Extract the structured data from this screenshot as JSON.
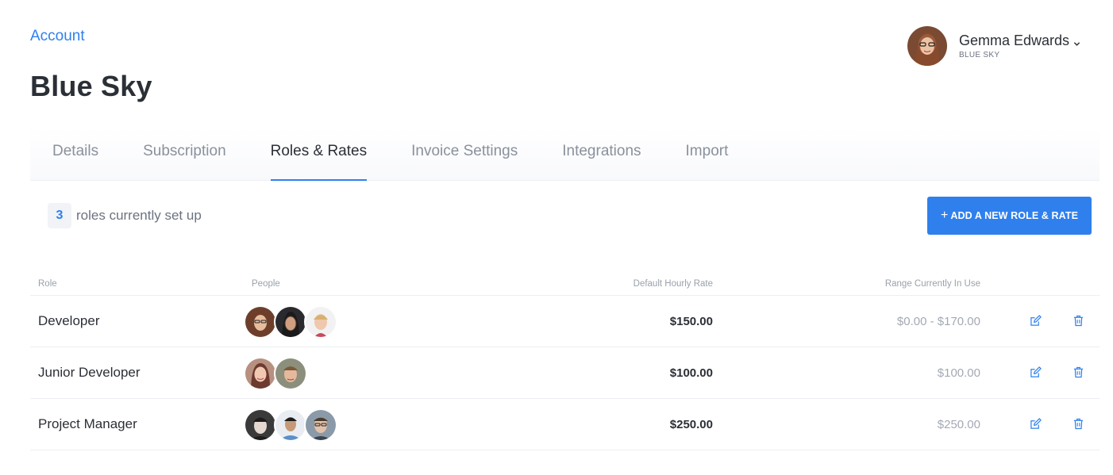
{
  "breadcrumb": "Account",
  "page_title": "Blue Sky",
  "user": {
    "name": "Gemma Edwards",
    "org": "BLUE SKY"
  },
  "tabs": [
    {
      "label": "Details",
      "active": false
    },
    {
      "label": "Subscription",
      "active": false
    },
    {
      "label": "Roles & Rates",
      "active": true
    },
    {
      "label": "Invoice Settings",
      "active": false
    },
    {
      "label": "Integrations",
      "active": false
    },
    {
      "label": "Import",
      "active": false
    }
  ],
  "summary": {
    "count": "3",
    "label": "roles currently set up"
  },
  "add_button": {
    "plus": "+",
    "label": "ADD A NEW ROLE & RATE"
  },
  "table": {
    "headers": {
      "role": "Role",
      "people": "People",
      "rate": "Default Hourly Rate",
      "range": "Range Currently In Use"
    },
    "rows": [
      {
        "role": "Developer",
        "rate": "$150.00",
        "range": "$0.00 - $170.00",
        "people_count": 3
      },
      {
        "role": "Junior Developer",
        "rate": "$100.00",
        "range": "$100.00",
        "people_count": 2
      },
      {
        "role": "Project Manager",
        "rate": "$250.00",
        "range": "$250.00",
        "people_count": 3
      }
    ]
  },
  "colors": {
    "accent": "#2f80ed",
    "text": "#2b2f36",
    "muted": "#8a919c"
  },
  "icons": {
    "edit": "edit-icon",
    "delete": "trash-icon",
    "user_menu": "chevron-down-icon"
  }
}
